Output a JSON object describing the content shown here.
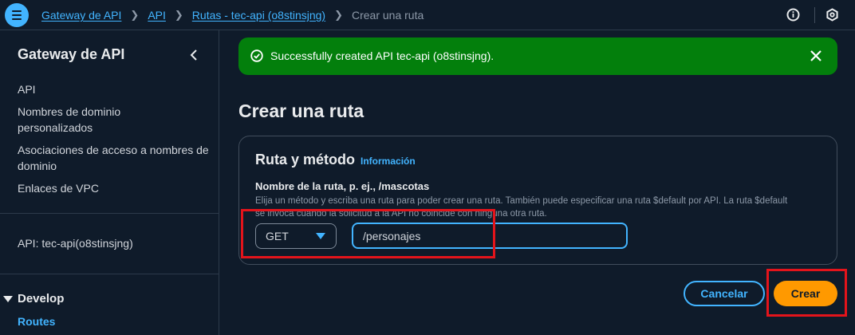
{
  "breadcrumb": {
    "items": [
      "Gateway de API",
      "API",
      "Rutas - tec-api (o8stinsjng)"
    ],
    "current": "Crear una ruta"
  },
  "sidebar": {
    "title": "Gateway de API",
    "items": [
      {
        "label": "API"
      },
      {
        "label": "Nombres de dominio personalizados"
      },
      {
        "label": "Asociaciones de acceso a nombres de dominio"
      },
      {
        "label": "Enlaces de VPC"
      }
    ],
    "api_label": "API: tec-api(o8stinsjng)",
    "section": "Develop",
    "active_item": "Routes"
  },
  "flash": {
    "message": "Successfully created API tec-api (o8stinsjng)."
  },
  "page": {
    "title": "Crear una ruta"
  },
  "form": {
    "section_title": "Ruta y método",
    "info_link": "Información",
    "field_label": "Nombre de la ruta, p. ej., /mascotas",
    "field_description": "Elija un método y escriba una ruta para poder crear una ruta. También puede especificar una ruta $default por API. La ruta $default se invoca cuando la solicitud a la API no coincide con ninguna otra ruta.",
    "method": "GET",
    "path_value": "/personajes"
  },
  "actions": {
    "cancel_label": "Cancelar",
    "create_label": "Crear"
  },
  "colors": {
    "accent": "#42b4ff",
    "success": "#037f0c",
    "primary_button": "#ff9900",
    "annotation": "#e3141b"
  }
}
